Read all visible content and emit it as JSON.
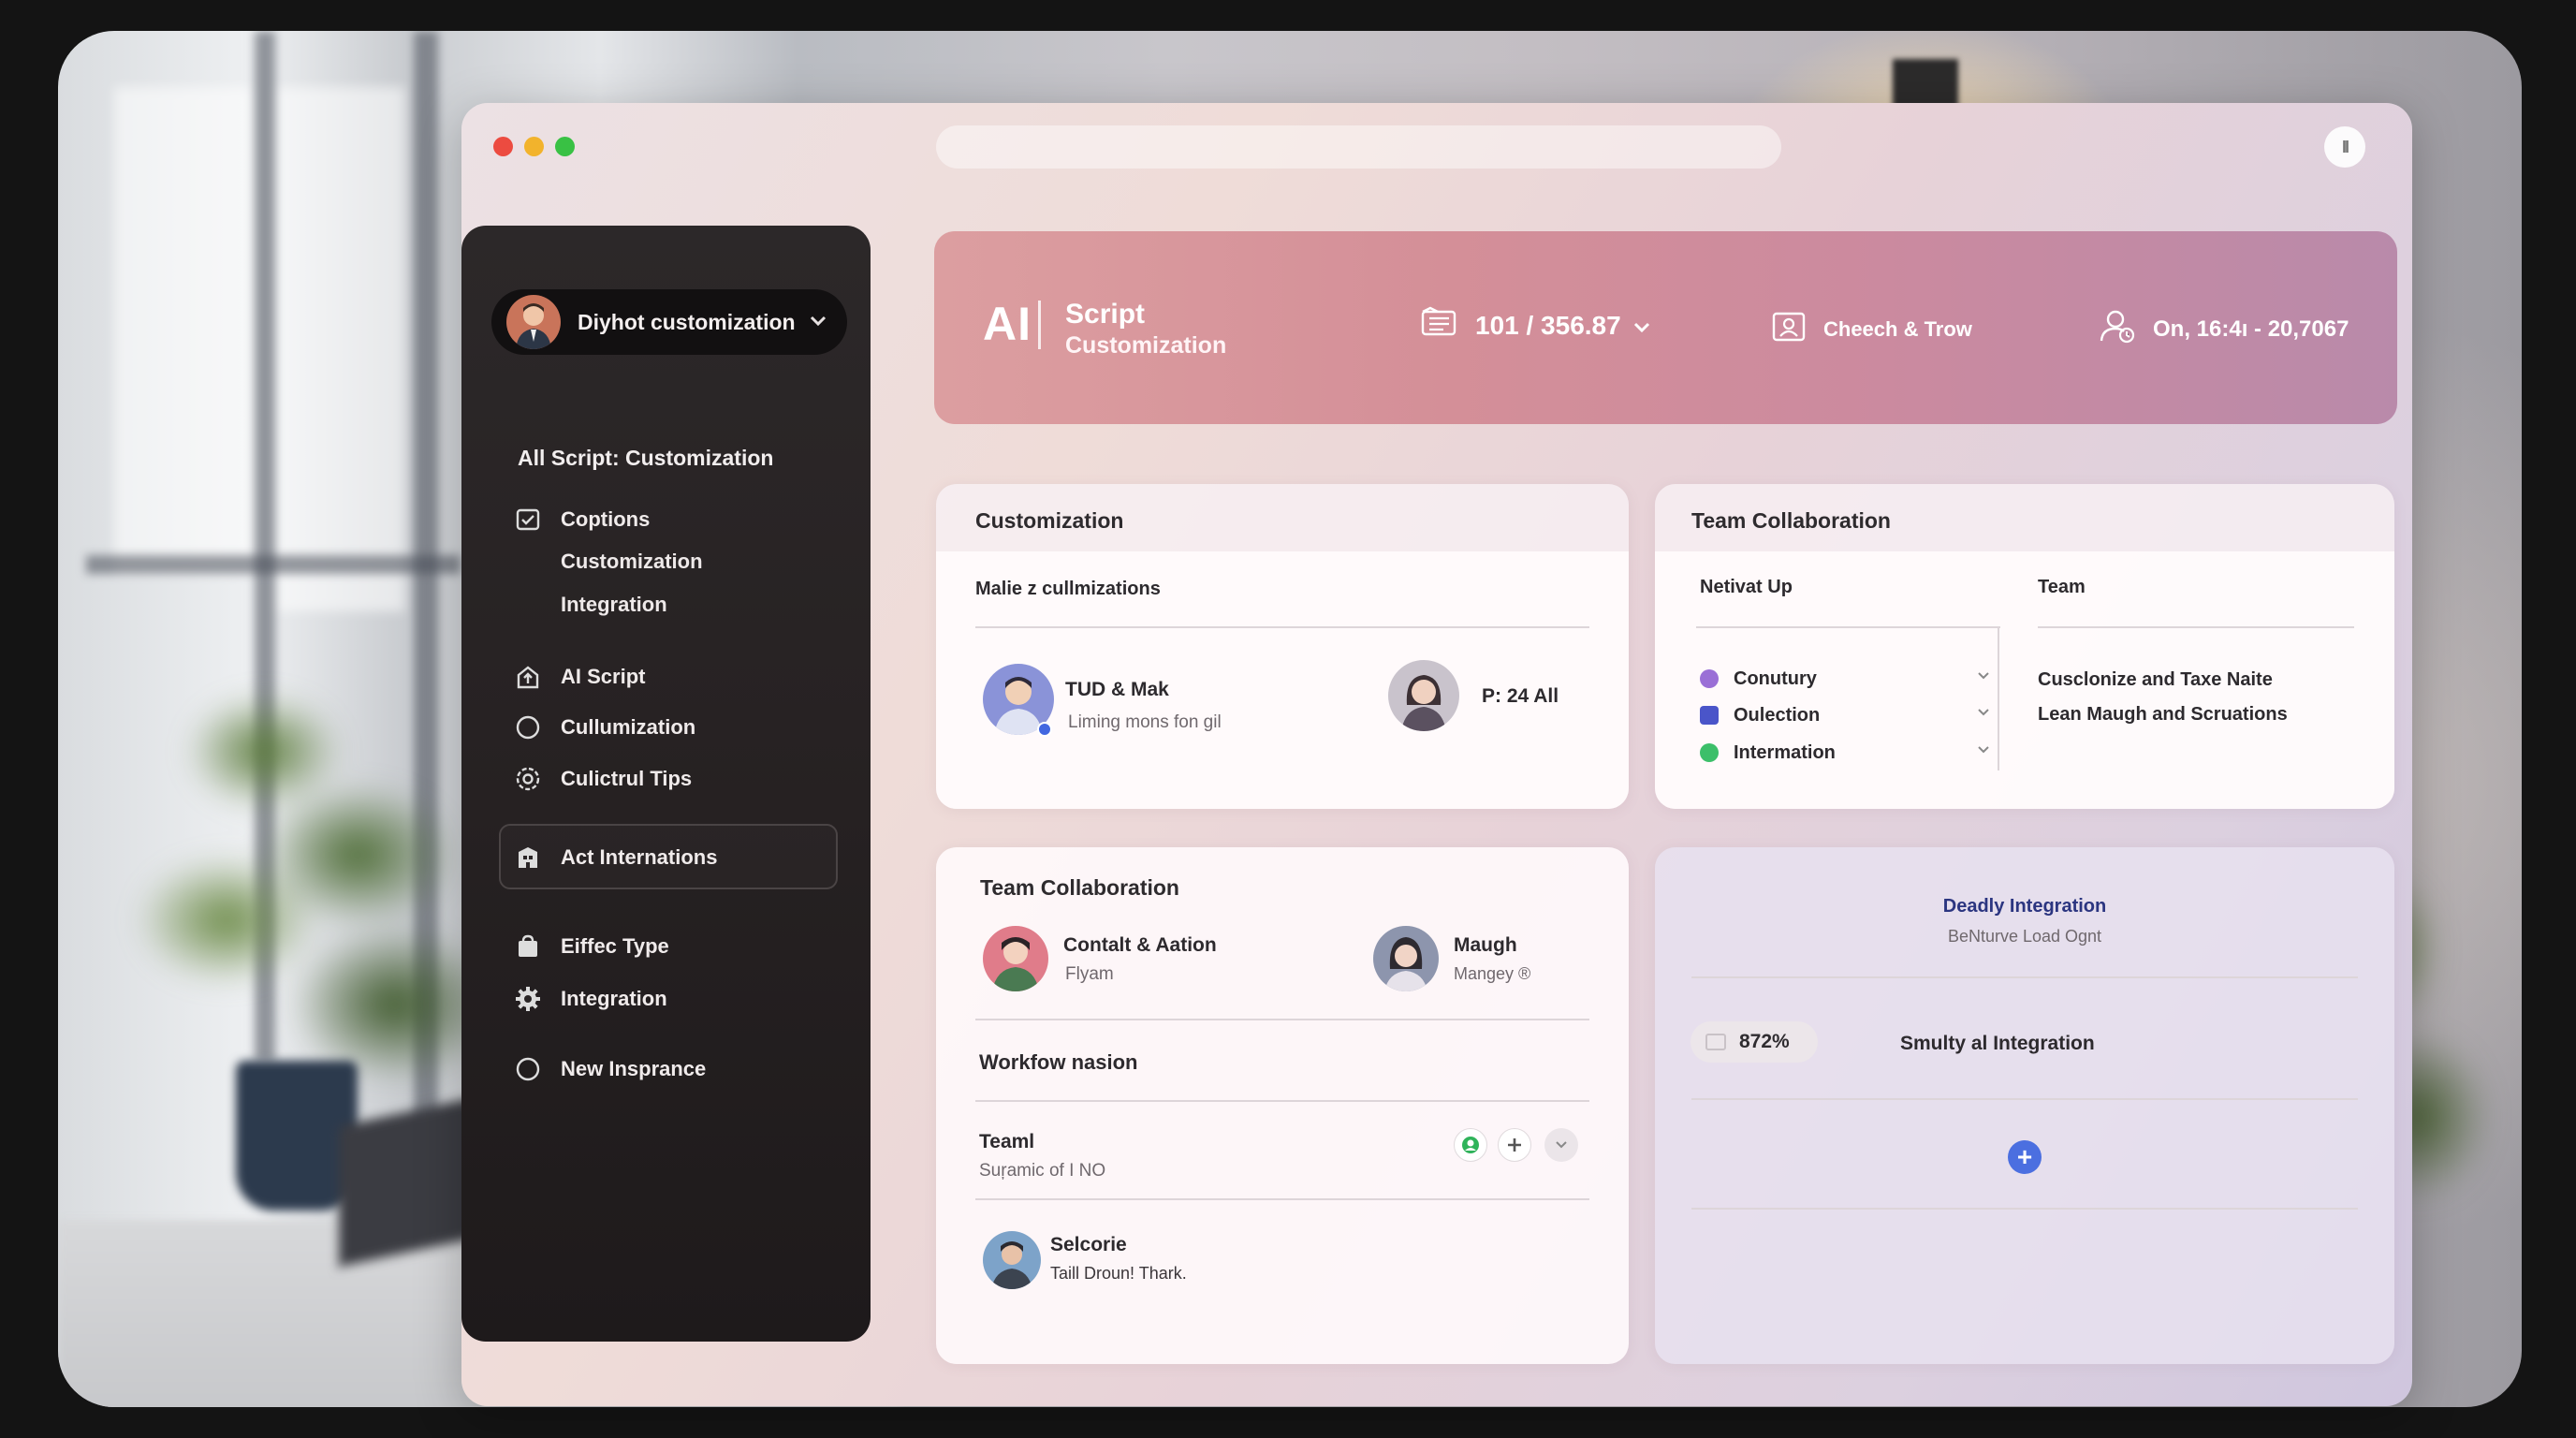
{
  "window": {
    "traffic_lights": [
      "#ec4b40",
      "#f2b32c",
      "#39c144"
    ],
    "pause_label": "II"
  },
  "sidebar": {
    "profile_name": "Diyhot customization",
    "heading": "All Script: Customization",
    "items": [
      {
        "label": "Coptions",
        "icon": "checkbox-icon"
      },
      {
        "label": "Customization"
      },
      {
        "label": "Integration"
      },
      {
        "label": "AI Script",
        "icon": "home-upload-icon"
      },
      {
        "label": "Cullumization",
        "icon": "circle-icon"
      },
      {
        "label": "Culictrul Tips",
        "icon": "settings-icon"
      },
      {
        "label": "Act Internations",
        "icon": "building-icon",
        "active": true
      },
      {
        "label": "Eiffec Type",
        "icon": "bag-icon"
      },
      {
        "label": "Integration",
        "icon": "gear-icon"
      },
      {
        "label": "New Insprance",
        "icon": "circle-icon"
      }
    ]
  },
  "header": {
    "logo": "AI",
    "title_line1": "Script",
    "title_line2": "Customization",
    "stat1": "101 / 356.87",
    "stat2": "Cheech & Trow",
    "stat3": "On, 16:4ı - 20,7067"
  },
  "customization_card": {
    "title": "Customization",
    "subtitle": "Malie z cullmizations",
    "person1_name": "TUD & Mak",
    "person1_desc": "Liming mons fon gil",
    "person2_label": "P: 24 All"
  },
  "team_collab_card": {
    "title": "Team Collaboration",
    "col1_header": "Netivat Up",
    "col2_header": "Team",
    "options": [
      {
        "label": "Conutury",
        "color": "#9a6fd6"
      },
      {
        "label": "Oulection",
        "color": "#4a55c9"
      },
      {
        "label": "Intermation",
        "color": "#3cbf6a"
      }
    ],
    "team_line1": "Cusclonize and Taxe Naite",
    "team_line2": "Lean Maugh and Scruations"
  },
  "team_collab_card2": {
    "title": "Team Collaboration",
    "person1_name": "Contalt & Aation",
    "person1_sub": "Flyam",
    "person2_name": "Maugh",
    "person2_sub": "Mangey ®",
    "workflow_title": "Workfow nasion",
    "row1_title": "Teaml",
    "row1_sub": "Suŗamic of I NO",
    "row2_title": "Selcorie",
    "row2_sub": "Taill Droun! Thark."
  },
  "integration_card": {
    "title": "Deadly Integration",
    "subtitle": "BeNturve Load Ognt",
    "pill_value": "872%",
    "integration_label": "Smulty al Integration",
    "add_label": "+"
  }
}
